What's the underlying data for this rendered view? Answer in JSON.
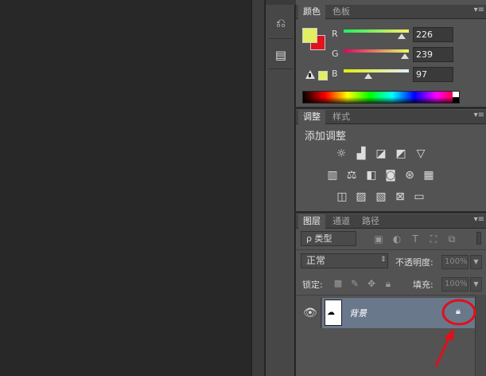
{
  "color_panel": {
    "tabs": [
      "颜色",
      "色板"
    ],
    "foreground": "#E2EF61",
    "background": "#E0141C",
    "channels": [
      {
        "label": "R",
        "value": "226",
        "level": 0.886
      },
      {
        "label": "G",
        "value": "239",
        "level": 0.937
      },
      {
        "label": "B",
        "value": "97",
        "level": 0.38
      }
    ],
    "warning_icon": "gamut-warning-icon"
  },
  "adjustments_panel": {
    "tabs": [
      "调整",
      "样式"
    ],
    "heading": "添加调整",
    "row1": [
      "brightness-contrast-icon",
      "levels-icon",
      "curves-icon",
      "exposure-icon",
      "vibrance-icon"
    ],
    "row2": [
      "hue-saturation-icon",
      "color-balance-icon",
      "black-white-icon",
      "photo-filter-icon",
      "channel-mixer-icon",
      "color-lookup-icon"
    ],
    "row3": [
      "invert-icon",
      "posterize-icon",
      "threshold-icon",
      "selective-color-icon",
      "gradient-map-icon"
    ]
  },
  "layers_panel": {
    "tabs": [
      "图层",
      "通道",
      "路径"
    ],
    "filter_label": "ρ 类型",
    "blend_mode": "正常",
    "opacity_label": "不透明度:",
    "opacity_value": "100%",
    "lock_label": "锁定:",
    "fill_label": "填充:",
    "fill_value": "100%",
    "layers": [
      {
        "name": "背景",
        "visible": true,
        "locked": true
      }
    ]
  },
  "annotation": {
    "color": "#E0101A"
  }
}
